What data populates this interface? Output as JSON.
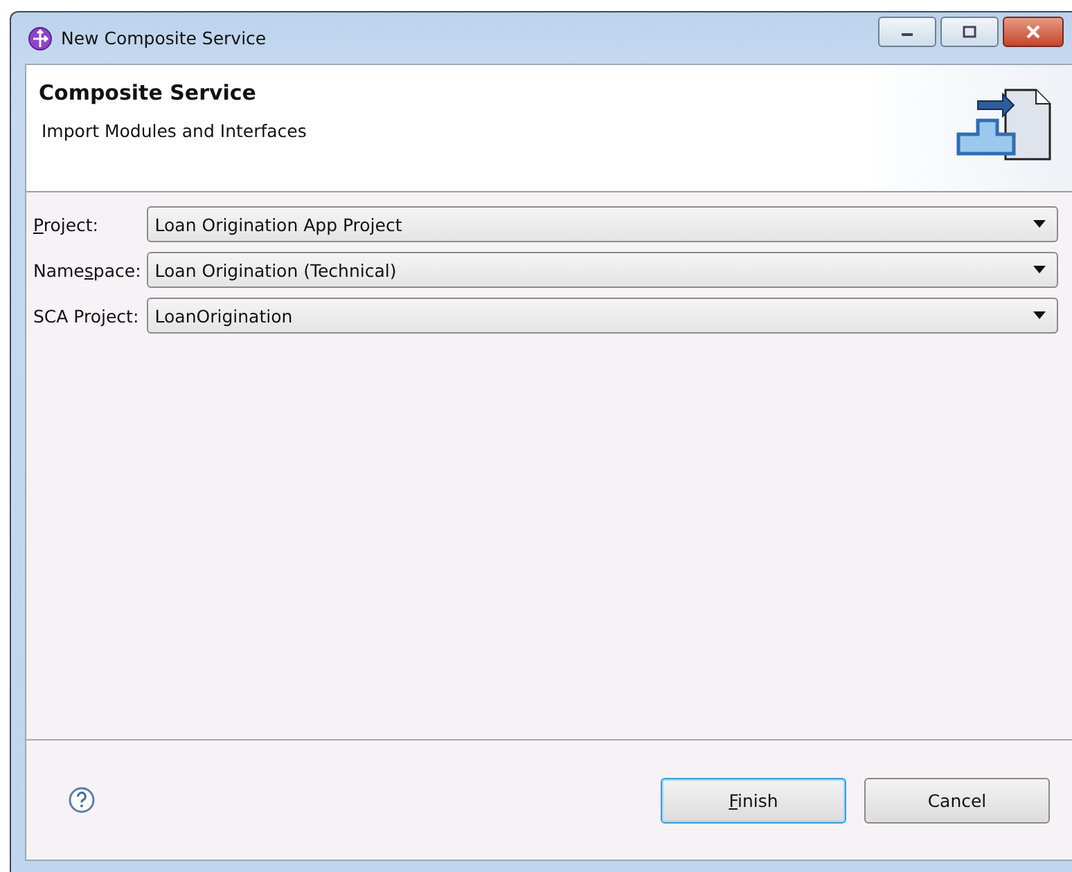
{
  "window": {
    "title": "New Composite Service"
  },
  "header": {
    "title": "Composite Service",
    "description": "Import Modules and Interfaces"
  },
  "fields": [
    {
      "label": {
        "key": "P",
        "after": "roject:"
      },
      "value": "Loan Origination App Project"
    },
    {
      "label": {
        "before": "Name",
        "key": "s",
        "after": "pace:"
      },
      "value": "Loan Origination (Technical)"
    },
    {
      "label": {
        "before": "SCA Project:"
      },
      "value": "LoanOrigination"
    }
  ],
  "buttons": [
    {
      "label": {
        "key": "F",
        "after": "inish"
      },
      "default": true
    },
    {
      "label": {
        "before": "Cancel"
      },
      "default": false
    }
  ]
}
